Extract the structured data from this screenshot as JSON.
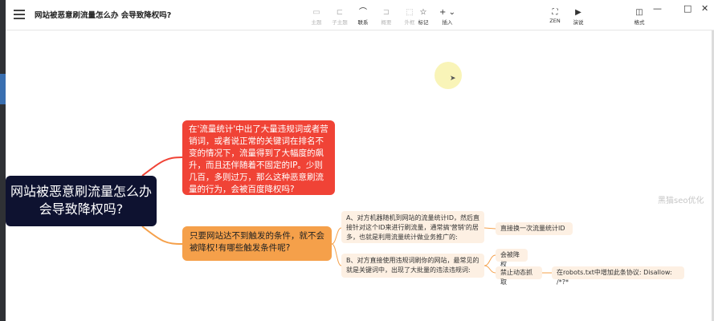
{
  "app": {
    "title": "网站被恶意刷流量怎么办 会导致降权吗?"
  },
  "toolbar": {
    "items": [
      {
        "label": "主题",
        "icon": "theme-icon"
      },
      {
        "label": "子主题",
        "icon": "subtopic-icon"
      },
      {
        "label": "联系",
        "icon": "relationship-icon"
      },
      {
        "label": "概要",
        "icon": "summary-icon"
      },
      {
        "label": "外框",
        "icon": "boundary-icon"
      },
      {
        "label": "标记",
        "icon": "star-icon"
      },
      {
        "label": "插入",
        "icon": "plus-icon"
      },
      {
        "label": "ZEN",
        "icon": "zen-icon"
      },
      {
        "label": "演说",
        "icon": "pitch-icon"
      },
      {
        "label": "格式",
        "icon": "format-icon"
      }
    ]
  },
  "window": {
    "minimize": "—",
    "maximize": "□",
    "close": "✕"
  },
  "mindmap": {
    "root": "网站被恶意刷流量怎么办 会导致降权吗?",
    "branch1": "在'流量统计'中出了大量违规词或者营销词，或者说正常的关键词在排名不变的情况下，流量得到了大幅度的飙升，而且还伴随着不固定的IP。少则几百，多则过万，那么这种恶意刷流量的行为，会被百度降权吗?",
    "branch2": "只要网站达不到触发的条件，就不会被降权!有哪些触发条件呢?",
    "sub_a": "A、对方机器随机到网站的流量统计ID，然后直接针对这个ID来进行刷流量，通常搞'营销'的居多，也就是利用流量统计做业务推广的:",
    "sub_b": "B、对方直接使用违规词刷你的网站，最常见的就是关键词中，出现了大批量的违法违规词:",
    "sub_c": "直接换一次流量统计ID",
    "sub_d": "会被降权",
    "sub_e": "禁止动态抓取",
    "sub_f": "在robots.txt中增加此条协议: Disallow: /*?*"
  },
  "watermark": "黑猫seo优化"
}
